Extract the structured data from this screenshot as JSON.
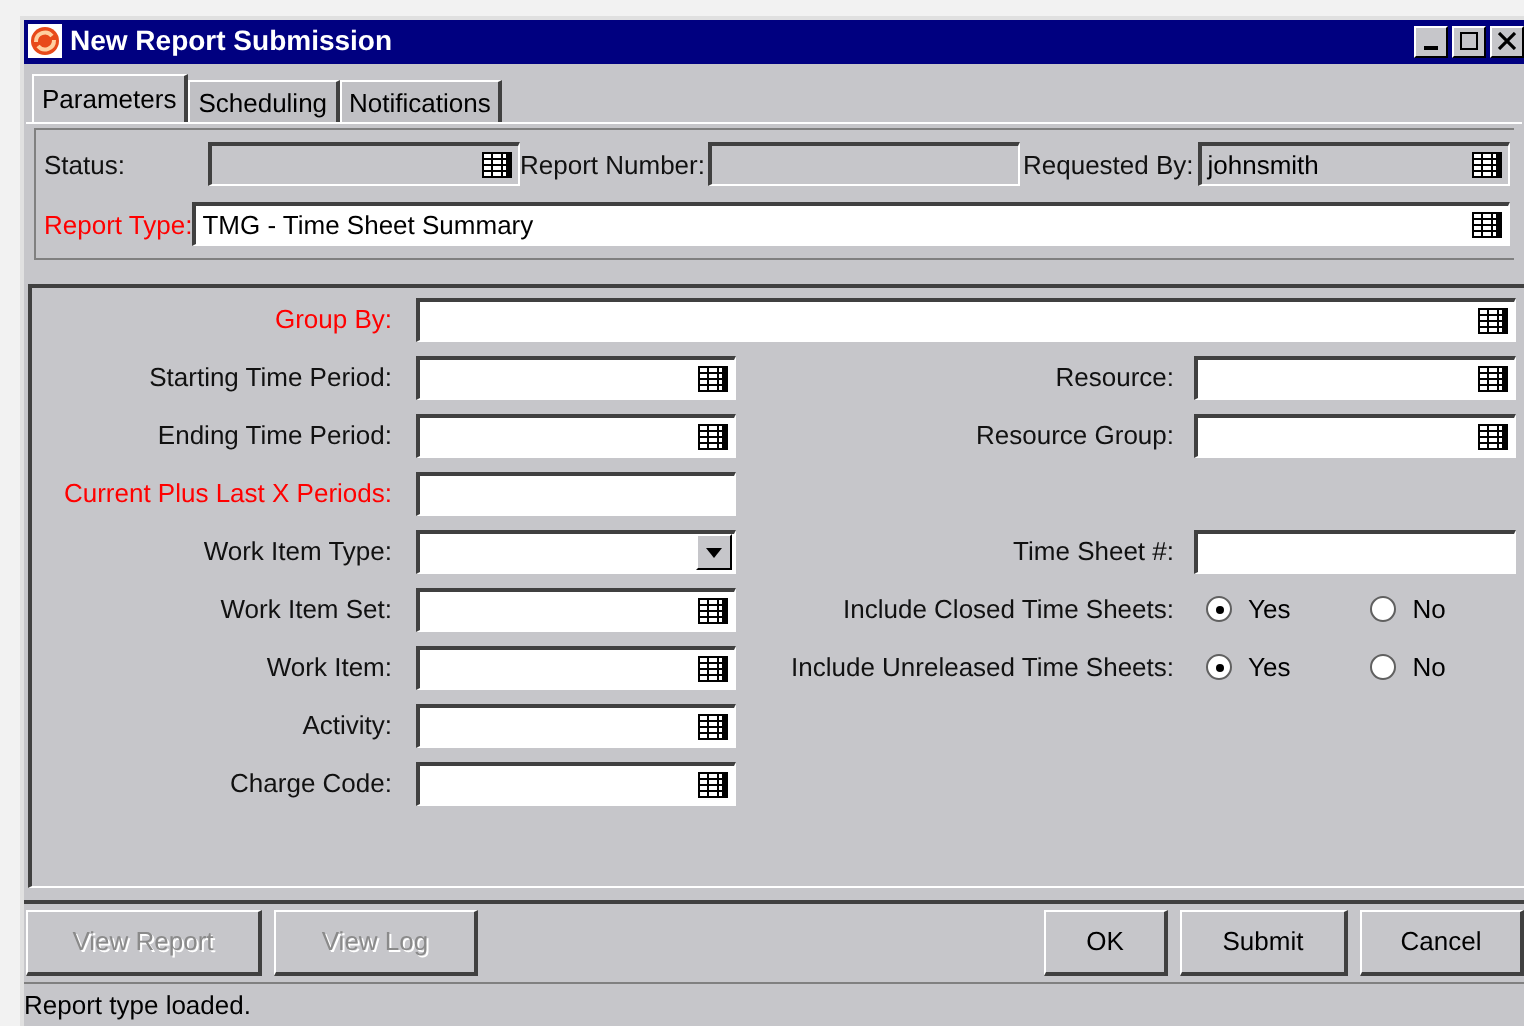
{
  "window": {
    "title": "New Report Submission"
  },
  "tabs": [
    {
      "label": "Parameters",
      "selected": true
    },
    {
      "label": "Scheduling",
      "selected": false
    },
    {
      "label": "Notifications",
      "selected": false
    }
  ],
  "header": {
    "status": {
      "label": "Status:",
      "disabled": true
    },
    "report_number": {
      "label": "Report Number:",
      "disabled": true
    },
    "requested_by": {
      "label": "Requested By:",
      "value": "johnsmith",
      "disabled": true
    },
    "report_type": {
      "label": "Report Type:",
      "value": "TMG - Time Sheet Summary",
      "required": true
    }
  },
  "form_rows": [
    {
      "wide": true,
      "left": {
        "label": "Group By:",
        "required": true,
        "kind": "lookup"
      }
    },
    {
      "wide": false,
      "left": {
        "label": "Starting Time Period:",
        "required": false,
        "kind": "lookup"
      },
      "right": {
        "label": "Resource:",
        "required": false,
        "kind": "lookup"
      }
    },
    {
      "wide": false,
      "left": {
        "label": "Ending Time Period:",
        "required": false,
        "kind": "lookup"
      },
      "right": {
        "label": "Resource Group:",
        "required": false,
        "kind": "lookup"
      }
    },
    {
      "wide": false,
      "left": {
        "label": "Current Plus Last X Periods:",
        "required": true,
        "kind": "text"
      }
    },
    {
      "wide": false,
      "left": {
        "label": "Work Item Type:",
        "required": false,
        "kind": "dropdown"
      },
      "right": {
        "label": "Time Sheet #:",
        "required": false,
        "kind": "text"
      }
    },
    {
      "wide": false,
      "left": {
        "label": "Work Item Set:",
        "required": false,
        "kind": "lookup"
      },
      "right": {
        "label": "Include Closed Time Sheets:",
        "required": false,
        "kind": "radio",
        "options": [
          {
            "label": "Yes",
            "selected": true
          },
          {
            "label": "No",
            "selected": false
          }
        ]
      }
    },
    {
      "wide": false,
      "left": {
        "label": "Work Item:",
        "required": false,
        "kind": "lookup"
      },
      "right": {
        "label": "Include Unreleased Time Sheets:",
        "required": false,
        "kind": "radio",
        "options": [
          {
            "label": "Yes",
            "selected": true
          },
          {
            "label": "No",
            "selected": false
          }
        ]
      }
    },
    {
      "wide": false,
      "left": {
        "label": "Activity:",
        "required": false,
        "kind": "lookup"
      }
    },
    {
      "wide": false,
      "left": {
        "label": "Charge Code:",
        "required": false,
        "kind": "lookup"
      }
    }
  ],
  "report_buttons": [
    {
      "label": "View Report",
      "disabled": true
    },
    {
      "label": "View Log",
      "disabled": true
    }
  ],
  "dialog_buttons": [
    {
      "label": "OK",
      "disabled": false
    },
    {
      "label": "Submit",
      "disabled": false
    },
    {
      "label": "Cancel",
      "disabled": false
    }
  ],
  "status_bar": "Report type loaded."
}
